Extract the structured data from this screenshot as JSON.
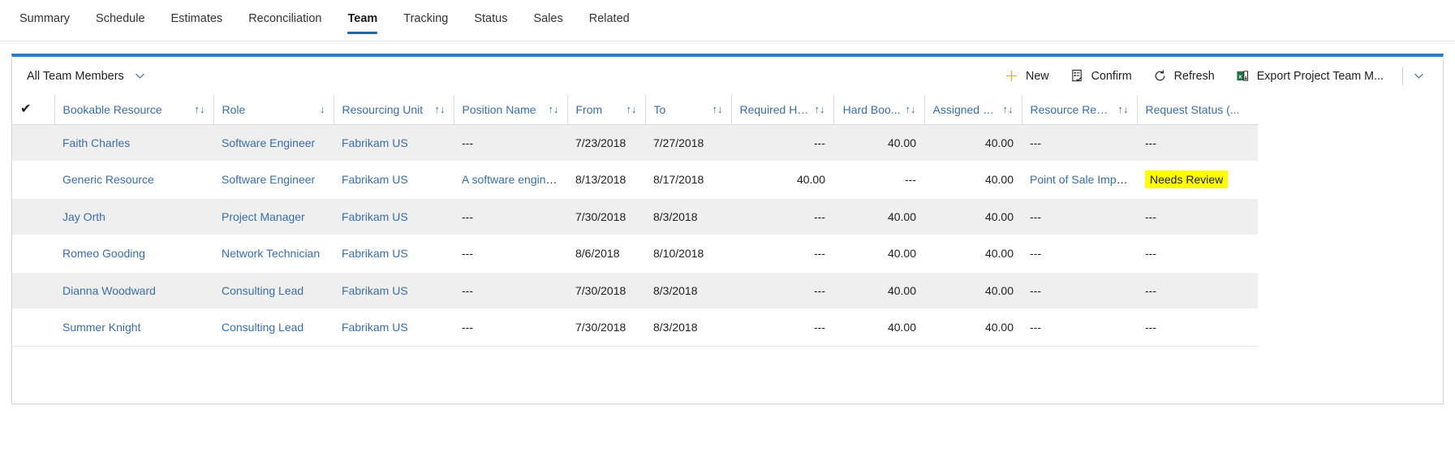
{
  "tabs": [
    {
      "label": "Summary",
      "active": false
    },
    {
      "label": "Schedule",
      "active": false
    },
    {
      "label": "Estimates",
      "active": false
    },
    {
      "label": "Reconciliation",
      "active": false
    },
    {
      "label": "Team",
      "active": true
    },
    {
      "label": "Tracking",
      "active": false
    },
    {
      "label": "Status",
      "active": false
    },
    {
      "label": "Sales",
      "active": false
    },
    {
      "label": "Related",
      "active": false
    }
  ],
  "commandbar": {
    "view_selector": "All Team Members",
    "view_chevron_icon": "chevron-down-icon",
    "buttons": [
      {
        "label": "New",
        "icon": "plus-icon"
      },
      {
        "label": "Confirm",
        "icon": "confirm-checklist-icon"
      },
      {
        "label": "Refresh",
        "icon": "refresh-icon"
      },
      {
        "label": "Export Project Team M...",
        "icon": "excel-export-icon"
      }
    ],
    "overflow_icon": "chevron-down-icon",
    "accent_color": "#2f79bd",
    "plus_color": "#d8b24a"
  },
  "grid": {
    "select_all_icon": "checkmark-icon",
    "columns": [
      {
        "label": "Bookable Resource",
        "sort": "unsorted",
        "align": "left"
      },
      {
        "label": "Role",
        "sort": "desc",
        "align": "left"
      },
      {
        "label": "Resourcing Unit",
        "sort": "unsorted",
        "align": "left"
      },
      {
        "label": "Position Name",
        "sort": "unsorted",
        "align": "left"
      },
      {
        "label": "From",
        "sort": "unsorted",
        "align": "left"
      },
      {
        "label": "To",
        "sort": "unsorted",
        "align": "left"
      },
      {
        "label": "Required Hours",
        "sort": "unsorted",
        "align": "right"
      },
      {
        "label": "Hard Boo...",
        "sort": "unsorted",
        "align": "right"
      },
      {
        "label": "Assigned Hours",
        "sort": "unsorted",
        "align": "right"
      },
      {
        "label": "Resource Require...",
        "sort": "unsorted",
        "align": "left"
      },
      {
        "label": "Request Status (...",
        "sort": "none",
        "align": "left"
      }
    ],
    "sort_glyphs": {
      "unsorted": "↑↓",
      "desc": "↓",
      "asc": "↑",
      "none": ""
    },
    "rows": [
      {
        "bookable_resource": "Faith Charles",
        "role": "Software Engineer",
        "resourcing_unit": "Fabrikam US",
        "position_name": "---",
        "from": "7/23/2018",
        "to": "7/27/2018",
        "required_hours": "---",
        "hard_booked": "40.00",
        "assigned_hours": "40.00",
        "resource_requirement": "---",
        "request_status": "---",
        "highlighted": false
      },
      {
        "bookable_resource": "Generic Resource",
        "role": "Software Engineer",
        "resourcing_unit": "Fabrikam US",
        "position_name": "A software engineer",
        "from": "8/13/2018",
        "to": "8/17/2018",
        "required_hours": "40.00",
        "hard_booked": "---",
        "assigned_hours": "40.00",
        "resource_requirement": "Point of Sale Impleme...",
        "request_status": "Needs Review",
        "highlighted": true
      },
      {
        "bookable_resource": "Jay Orth",
        "role": "Project Manager",
        "resourcing_unit": "Fabrikam US",
        "position_name": "---",
        "from": "7/30/2018",
        "to": "8/3/2018",
        "required_hours": "---",
        "hard_booked": "40.00",
        "assigned_hours": "40.00",
        "resource_requirement": "---",
        "request_status": "---",
        "highlighted": false
      },
      {
        "bookable_resource": "Romeo Gooding",
        "role": "Network Technician",
        "resourcing_unit": "Fabrikam US",
        "position_name": "---",
        "from": "8/6/2018",
        "to": "8/10/2018",
        "required_hours": "---",
        "hard_booked": "40.00",
        "assigned_hours": "40.00",
        "resource_requirement": "---",
        "request_status": "---",
        "highlighted": false
      },
      {
        "bookable_resource": "Dianna Woodward",
        "role": "Consulting Lead",
        "resourcing_unit": "Fabrikam US",
        "position_name": "---",
        "from": "7/30/2018",
        "to": "8/3/2018",
        "required_hours": "---",
        "hard_booked": "40.00",
        "assigned_hours": "40.00",
        "resource_requirement": "---",
        "request_status": "---",
        "highlighted": false
      },
      {
        "bookable_resource": "Summer Knight",
        "role": "Consulting Lead",
        "resourcing_unit": "Fabrikam US",
        "position_name": "---",
        "from": "7/30/2018",
        "to": "8/3/2018",
        "required_hours": "---",
        "hard_booked": "40.00",
        "assigned_hours": "40.00",
        "resource_requirement": "---",
        "request_status": "---",
        "highlighted": false
      }
    ],
    "highlight_color": "#ffff00",
    "link_color": "#3b6ea8"
  }
}
